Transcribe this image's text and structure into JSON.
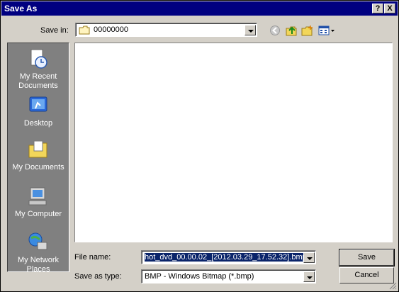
{
  "window": {
    "title": "Save As",
    "help_glyph": "?",
    "close_glyph": "X"
  },
  "save_in": {
    "label": "Save in:",
    "folder": "00000000"
  },
  "places": [
    {
      "label": "My Recent Documents",
      "icon": "recent-documents-icon"
    },
    {
      "label": "Desktop",
      "icon": "desktop-icon"
    },
    {
      "label": "My Documents",
      "icon": "my-documents-icon"
    },
    {
      "label": "My Computer",
      "icon": "my-computer-icon"
    },
    {
      "label": "My Network Places",
      "icon": "network-places-icon"
    }
  ],
  "file_name": {
    "label": "File name:",
    "value": "hot_dvd_00.00.02_[2012.03.29_17.52.32].bmp"
  },
  "save_type": {
    "label": "Save as type:",
    "value": "BMP - Windows Bitmap (*.bmp)"
  },
  "buttons": {
    "save": "Save",
    "cancel": "Cancel"
  }
}
